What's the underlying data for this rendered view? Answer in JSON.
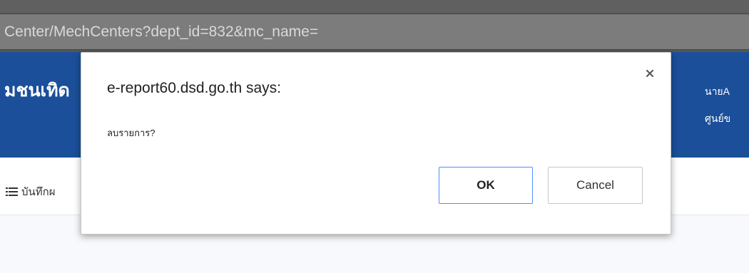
{
  "browser": {
    "url": "Center/MechCenters?dept_id=832&mc_name="
  },
  "site_header": {
    "title": "มชนเทิด",
    "user_line": "นายA",
    "dept_line": "ศูนย์ข"
  },
  "subnav": {
    "item_label": "บันทึกผ",
    "item_icon": "list-icon"
  },
  "dialog": {
    "title": "e-report60.dsd.go.th says:",
    "message": "ลบรายการ?",
    "ok_label": "OK",
    "cancel_label": "Cancel",
    "close_icon": "close-icon",
    "accent_color": "#4d90fe"
  },
  "colors": {
    "header_bg": "#1b4f99",
    "url_bar_bg": "#7c7c7c",
    "page_bg": "#f7f9fc"
  }
}
